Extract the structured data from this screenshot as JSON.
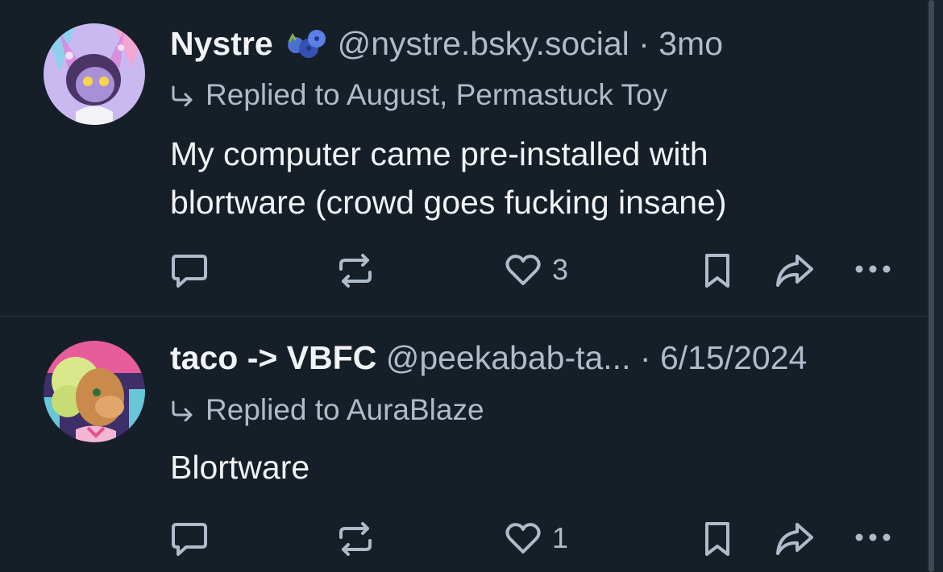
{
  "posts": [
    {
      "author": "Nystre",
      "badge_icon": "blueberries-emoji-icon",
      "handle": "@nystre.bsky.social",
      "separator": "·",
      "time": "3mo",
      "reply_to": "Replied to August, Permastuck Toy",
      "text_lines": [
        "My computer came pre-installed with",
        "blortware (crowd goes fucking insane)"
      ],
      "like_count": "3"
    },
    {
      "author": "taco -> VBFC",
      "handle": "@peekabab-ta...",
      "separator": "·",
      "time": "6/15/2024",
      "reply_to": "Replied to AuraBlaze",
      "text_lines": [
        "Blortware"
      ],
      "like_count": "1"
    }
  ],
  "colors": {
    "background": "#161e28",
    "primary_text": "#f1f3f5",
    "secondary_text": "#aebbc9",
    "divider": "#2c3642"
  }
}
